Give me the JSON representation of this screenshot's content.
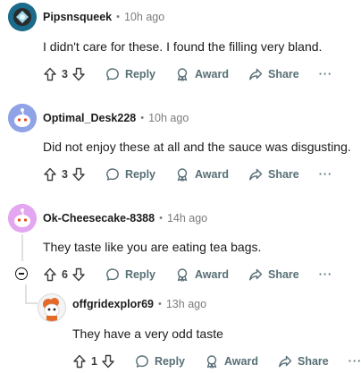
{
  "comments": [
    {
      "username": "Pipsnsqueek",
      "time": "10h ago",
      "text": "I didn't care for these. I found the filling very bland.",
      "votes": "3",
      "reply": "Reply",
      "award": "Award",
      "share": "Share",
      "more": "···",
      "avatar_color": "#1b6b8a"
    },
    {
      "username": "Optimal_Desk228",
      "time": "10h ago",
      "text": "Did not enjoy these at all and the sauce was disgusting.",
      "votes": "3",
      "reply": "Reply",
      "award": "Award",
      "share": "Share",
      "more": "···",
      "avatar_color": "#8fa3e6"
    },
    {
      "username": "Ok-Cheesecake-8388",
      "time": "14h ago",
      "text": "They taste like you are eating tea bags.",
      "votes": "6",
      "reply": "Reply",
      "award": "Award",
      "share": "Share",
      "more": "···",
      "avatar_color": "#e3a6f0"
    },
    {
      "username": "offgridexplor69",
      "time": "13h ago",
      "text": "They have a very odd taste",
      "votes": "1",
      "reply": "Reply",
      "award": "Award",
      "share": "Share",
      "more": "···",
      "avatar_color": "#f2f2f2"
    }
  ]
}
